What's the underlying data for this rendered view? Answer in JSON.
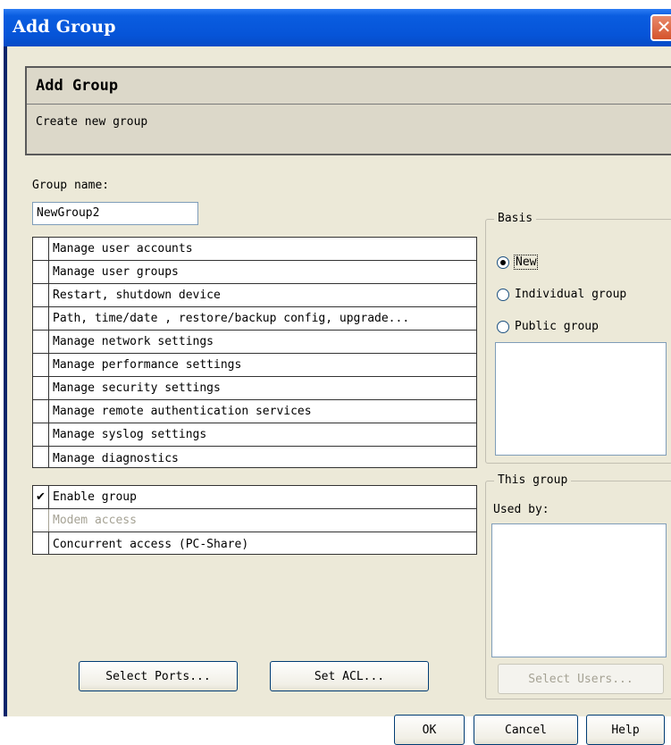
{
  "window": {
    "title": "Add Group"
  },
  "header": {
    "title": "Add Group",
    "description": "Create new group"
  },
  "form": {
    "group_name_label": "Group name:",
    "group_name_value": "NewGroup2"
  },
  "permissions": [
    {
      "label": "Manage user accounts",
      "checked": false
    },
    {
      "label": "Manage user groups",
      "checked": false
    },
    {
      "label": "Restart, shutdown device",
      "checked": false
    },
    {
      "label": "Path, time/date , restore/backup config, upgrade...",
      "checked": false
    },
    {
      "label": "Manage network settings",
      "checked": false
    },
    {
      "label": "Manage performance settings",
      "checked": false
    },
    {
      "label": "Manage security settings",
      "checked": false
    },
    {
      "label": "Manage remote authentication services",
      "checked": false
    },
    {
      "label": "Manage syslog settings",
      "checked": false
    },
    {
      "label": "Manage diagnostics",
      "checked": false
    }
  ],
  "options": [
    {
      "label": "Enable group",
      "checked": true,
      "enabled": true
    },
    {
      "label": "Modem access",
      "checked": false,
      "enabled": false
    },
    {
      "label": "Concurrent access (PC-Share)",
      "checked": false,
      "enabled": true
    }
  ],
  "basis": {
    "legend": "Basis",
    "radios": [
      {
        "label": "New",
        "selected": true
      },
      {
        "label": "Individual group",
        "selected": false
      },
      {
        "label": "Public group",
        "selected": false
      }
    ]
  },
  "this_group": {
    "legend": "This group",
    "used_by_label": "Used by:"
  },
  "buttons": {
    "select_ports": "Select Ports...",
    "set_acl": "Set ACL...",
    "select_users": "Select Users...",
    "ok": "OK",
    "cancel": "Cancel",
    "help": "Help"
  },
  "icons": {
    "close": "close-icon",
    "checkmark": "checkmark-icon"
  },
  "colors": {
    "titlebar": "#0654d8",
    "close_button": "#d4532c",
    "dialog_bg": "#ece9d8"
  }
}
